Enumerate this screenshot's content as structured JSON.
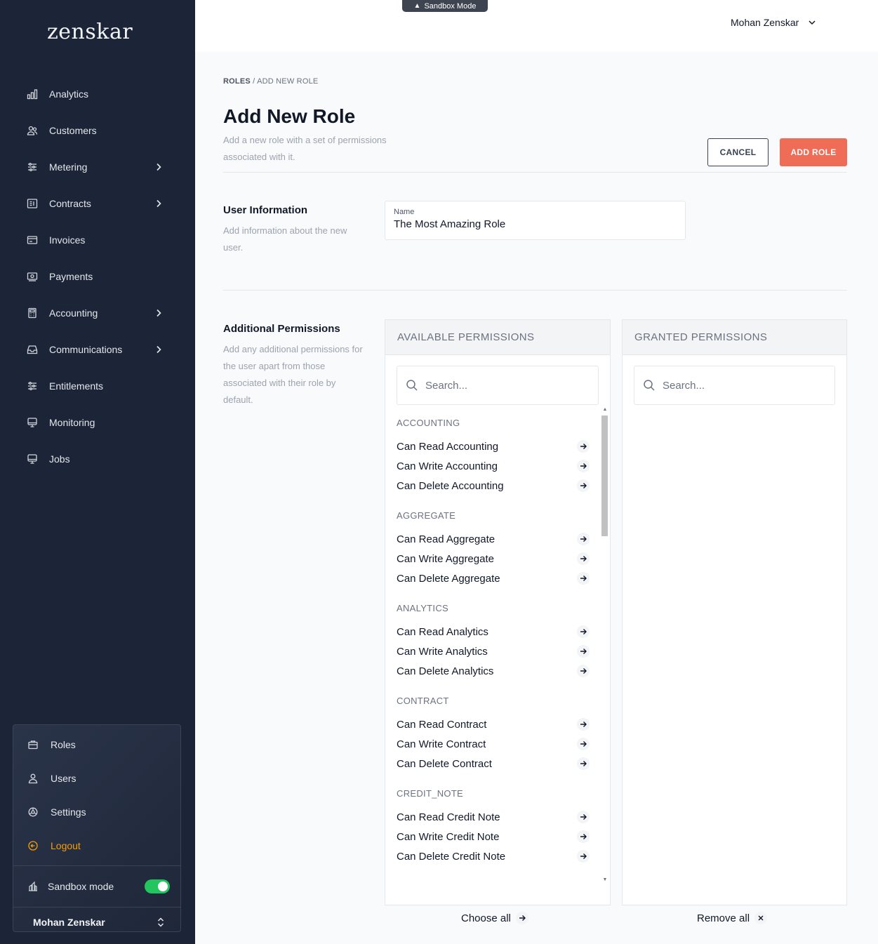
{
  "sidebar": {
    "logo": "zenskar",
    "items": [
      {
        "label": "Analytics",
        "icon": "bar-chart-icon",
        "expandable": false
      },
      {
        "label": "Customers",
        "icon": "users-icon",
        "expandable": false
      },
      {
        "label": "Metering",
        "icon": "sliders-icon",
        "expandable": true
      },
      {
        "label": "Contracts",
        "icon": "contract-icon",
        "expandable": true
      },
      {
        "label": "Invoices",
        "icon": "invoice-icon",
        "expandable": false
      },
      {
        "label": "Payments",
        "icon": "payment-icon",
        "expandable": false
      },
      {
        "label": "Accounting",
        "icon": "calculator-icon",
        "expandable": true
      },
      {
        "label": "Communications",
        "icon": "inbox-icon",
        "expandable": true
      },
      {
        "label": "Entitlements",
        "icon": "sliders-icon",
        "expandable": false
      },
      {
        "label": "Monitoring",
        "icon": "monitor-icon",
        "expandable": false
      },
      {
        "label": "Jobs",
        "icon": "monitor-icon",
        "expandable": false
      }
    ],
    "bottom": {
      "roles": "Roles",
      "users": "Users",
      "settings": "Settings",
      "logout": "Logout",
      "sandbox_label": "Sandbox mode",
      "sandbox_on": true,
      "user_name": "Mohan Zenskar"
    }
  },
  "topbar": {
    "sandbox_badge": "Sandbox Mode",
    "user_name": "Mohan Zenskar"
  },
  "breadcrumb": {
    "parent": "ROLES",
    "separator": " / ",
    "current": "ADD NEW ROLE"
  },
  "page": {
    "title": "Add New Role",
    "description": "Add a new role with a set of permissions associated with it.",
    "cancel_label": "CANCEL",
    "add_label": "ADD ROLE"
  },
  "user_info": {
    "title": "User Information",
    "description": "Add information about the new user.",
    "name_label": "Name",
    "name_value": "The Most Amazing Role"
  },
  "permissions": {
    "title": "Additional Permissions",
    "description": "Add any additional permissions for the user apart from those associated with their role by default.",
    "available_header": "AVAILABLE PERMISSIONS",
    "granted_header": "GRANTED PERMISSIONS",
    "search_placeholder": "Search...",
    "groups": [
      {
        "name": "ACCOUNTING",
        "items": [
          "Can Read Accounting",
          "Can Write Accounting",
          "Can Delete Accounting"
        ]
      },
      {
        "name": "AGGREGATE",
        "items": [
          "Can Read Aggregate",
          "Can Write Aggregate",
          "Can Delete Aggregate"
        ]
      },
      {
        "name": "ANALYTICS",
        "items": [
          "Can Read Analytics",
          "Can Write Analytics",
          "Can Delete Analytics"
        ]
      },
      {
        "name": "CONTRACT",
        "items": [
          "Can Read Contract",
          "Can Write Contract",
          "Can Delete Contract"
        ]
      },
      {
        "name": "CREDIT_NOTE",
        "items": [
          "Can Read Credit Note",
          "Can Write Credit Note",
          "Can Delete Credit Note"
        ]
      }
    ],
    "choose_all": "Choose all",
    "remove_all": "Remove all"
  },
  "colors": {
    "sidebar_bg": "#1c2437",
    "accent": "#ef6c57",
    "logout": "#f59e0b",
    "toggle_on": "#22c55e"
  }
}
